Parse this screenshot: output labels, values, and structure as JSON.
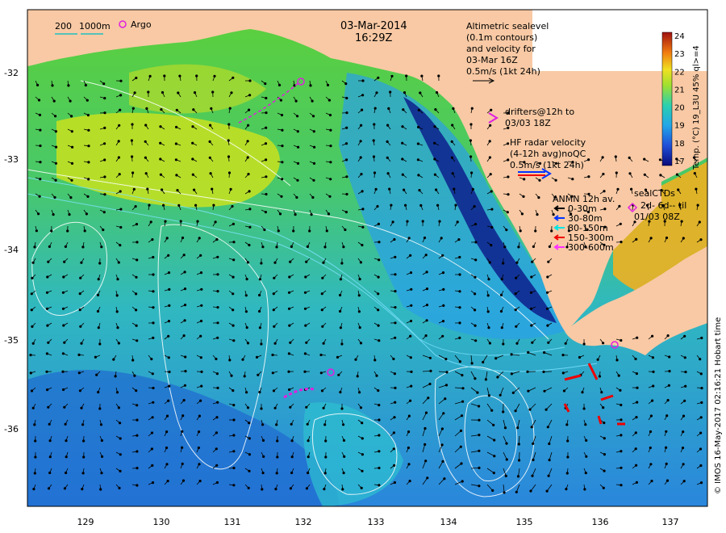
{
  "header": {
    "date": "03-Mar-2014",
    "time": "16:29Z"
  },
  "scale": {
    "label_a": "200",
    "label_b": "1000m"
  },
  "argo": {
    "label": "Argo"
  },
  "altimetry": {
    "lines": [
      "Altimetric sealevel",
      "(0.1m contours)",
      "and velocity for",
      "03-Mar 16Z",
      "0.5m/s (1kt 24h)"
    ]
  },
  "drifters": {
    "lines": [
      "drifters@12h to",
      "03/03 18Z"
    ]
  },
  "hf_radar": {
    "lines": [
      "HF radar velocity",
      "(4-12h avg)noQC",
      "0.5m/s (1kt 24h)"
    ]
  },
  "anmn": {
    "title": "ANMN 12h av.",
    "items": [
      {
        "label": "0-30m",
        "color": "#000000"
      },
      {
        "label": "30-80m",
        "color": "#0033ff"
      },
      {
        "label": "80-150m",
        "color": "#00e5e5"
      },
      {
        "label": "150-300m",
        "color": "#ee0000"
      },
      {
        "label": "300-600m",
        "color": "#ff33ff"
      }
    ]
  },
  "seal_ctds": {
    "lines": [
      "sealCTDs",
      "2d- 6d-- til",
      "01/03 08Z"
    ]
  },
  "colorbar": {
    "label": "Temp. (°C) 19_L3U 45% ql>=4",
    "ticks": [
      "17",
      "18",
      "19",
      "20",
      "21",
      "22",
      "23",
      "24"
    ]
  },
  "credit": "© IMOS 16-May-2017 02:16:21 Hobart time",
  "axes": {
    "x_ticks": [
      "129",
      "130",
      "131",
      "132",
      "133",
      "134",
      "135",
      "136",
      "137"
    ],
    "y_ticks": [
      "-32",
      "-33",
      "-34",
      "-35",
      "-36"
    ]
  },
  "colors": {
    "land": "#f8c9a4",
    "sea_warm": "#c8e020",
    "sea_mid": "#2ec0a0",
    "sea_cool": "#1f7ad6",
    "sea_cold": "#0d1f8c",
    "drifter_magenta": "#e020e0"
  }
}
